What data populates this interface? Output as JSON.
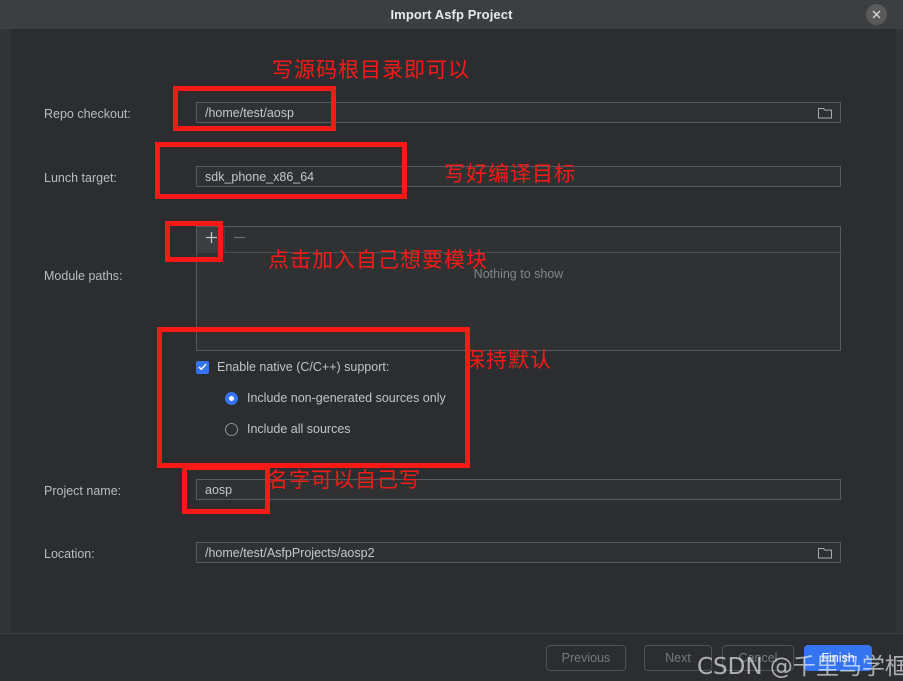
{
  "window": {
    "title": "Import Asfp Project",
    "close_icon": "close-icon"
  },
  "form": {
    "repo_checkout": {
      "label": "Repo checkout:",
      "value": "/home/test/aosp",
      "browse_icon": "folder-icon"
    },
    "lunch_target": {
      "label": "Lunch target:",
      "value": "sdk_phone_x86_64"
    },
    "module_paths": {
      "label": "Module paths:",
      "add_icon": "plus-icon",
      "remove_icon": "minus-icon",
      "empty_text": "Nothing to show"
    },
    "native": {
      "checkbox_label": "Enable native (C/C++) support:",
      "checkbox_checked": true,
      "options": [
        {
          "label": "Include non-generated sources only",
          "selected": true
        },
        {
          "label": "Include all sources",
          "selected": false
        }
      ]
    },
    "project_name": {
      "label": "Project name:",
      "value": "aosp"
    },
    "location": {
      "label": "Location:",
      "value": "/home/test/AsfpProjects/aosp2",
      "browse_icon": "folder-icon"
    }
  },
  "footer": {
    "previous": "Previous",
    "next": "Next",
    "cancel": "Cancel",
    "finish": "Finish"
  },
  "annotations": {
    "repo_hint": "写源码根目录即可以",
    "lunch_hint": "写好编译目标",
    "module_hint": "点击加入自己想要模块",
    "native_hint": "保持默认",
    "name_hint": "名字可以自己写",
    "color": "#f91a16"
  },
  "watermark": {
    "text": "CSDN @千里马学框架"
  }
}
